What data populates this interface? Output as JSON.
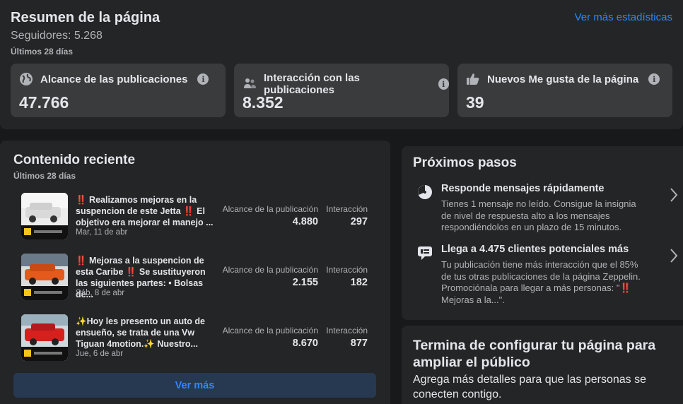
{
  "summary": {
    "title": "Resumen de la página",
    "followers": "Seguidores: 5.268",
    "period": "Últimos 28 días",
    "more_stats_link": "Ver más estadísticas",
    "stats": [
      {
        "label": "Alcance de las publicaciones",
        "value": "47.766",
        "icon": "globe-icon"
      },
      {
        "label": "Interacción con las publicaciones",
        "value": "8.352",
        "icon": "people-icon"
      },
      {
        "label": "Nuevos Me gusta de la página",
        "value": "39",
        "icon": "thumbs-up-icon"
      }
    ],
    "info_glyph": "i"
  },
  "recent": {
    "title": "Contenido reciente",
    "period": "Últimos 28 días",
    "reach_label": "Alcance de la publicación",
    "engagement_label": "Interacción",
    "posts": [
      {
        "text": "‼️ Realizamos mejoras en la suspencion de este Jetta ‼️ El objetivo era mejorar el manejo ...",
        "date": "Mar, 11 de abr",
        "reach": "4.880",
        "engagement": "297"
      },
      {
        "text": "‼️ Mejoras a la suspencion de esta Caribe ‼️ Se sustituyeron las siguientes partes: • Bolsas de...",
        "date": "Sáb, 8 de abr",
        "reach": "2.155",
        "engagement": "182"
      },
      {
        "text": "✨Hoy les presento un auto de ensueño, se trata de una Vw Tiguan 4motion.✨ Nuestro...",
        "date": "Jue, 6 de abr",
        "reach": "8.670",
        "engagement": "877"
      }
    ],
    "more_button": "Ver más"
  },
  "next_steps": {
    "title": "Próximos pasos",
    "items": [
      {
        "title": "Responde mensajes rápidamente",
        "desc": "Tienes 1 mensaje no leído. Consigue la insignia de nivel de respuesta alto a los mensajes respondiéndolos en un plazo de 15 minutos.",
        "icon": "response-clock-icon"
      },
      {
        "title": "Llega a 4.475 clientes potenciales más",
        "desc": "Tu publicación tiene más interacción que el 85% de tus otras publicaciones de la página Zeppelin. Promociónala para llegar a más personas: \"‼️ Mejoras a la...\".",
        "icon": "megaphone-icon"
      }
    ]
  },
  "setup": {
    "title": "Termina de configurar tu página para ampliar el público",
    "desc": "Agrega más detalles para que las personas se conecten contigo."
  },
  "colors": {
    "background": "#18191a",
    "card": "#242526",
    "stat_card": "#3a3b3c",
    "accent": "#2d88ff",
    "button_bg": "#263951",
    "text_primary": "#e4e6eb",
    "text_secondary": "#b0b3b8"
  }
}
